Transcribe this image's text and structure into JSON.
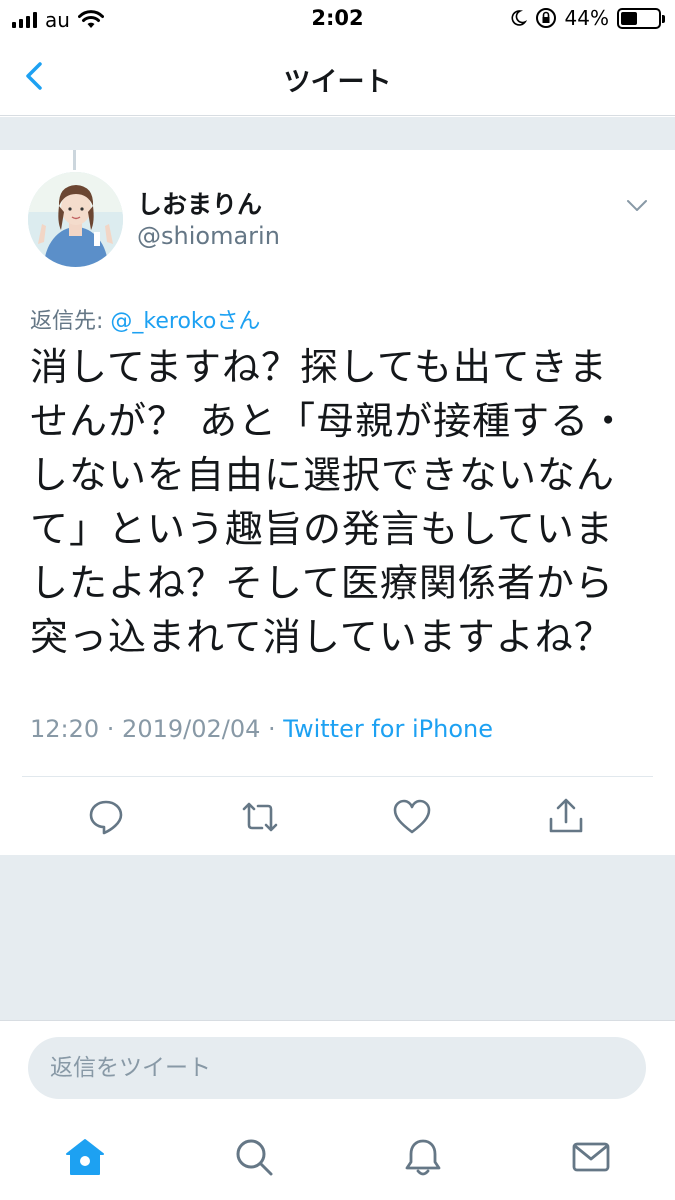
{
  "status_bar": {
    "carrier": "au",
    "time": "2:02",
    "battery_percent": "44%",
    "battery_level": 0.44
  },
  "nav": {
    "title": "ツイート",
    "back_icon": "chevron-left-icon"
  },
  "tweet": {
    "display_name": "しおまりん",
    "handle": "@shiomarin",
    "reply_prefix": "返信先: ",
    "reply_mention": "@_kerokoさん",
    "lines": [
      "消してますね？探しても出てきま",
      "せんが？ あと「母親が接種する・",
      "しないを自由に選択できないなん",
      "て」という趣旨の発言もしていま",
      "したよね？そして医療関係者から",
      "突っ込まれて消していますよね？"
    ],
    "timestamp": "12:20 · 2019/02/04 · ",
    "source": "Twitter for iPhone"
  },
  "actions": [
    "reply-icon",
    "retweet-icon",
    "like-icon",
    "share-icon"
  ],
  "reply_bar": {
    "placeholder": "返信をツイート"
  },
  "tabs": [
    "home-icon",
    "search-icon",
    "notifications-icon",
    "messages-icon"
  ],
  "colors": {
    "accent": "#1da1f2",
    "muted": "#657786",
    "background_gray": "#e6ecf0"
  }
}
